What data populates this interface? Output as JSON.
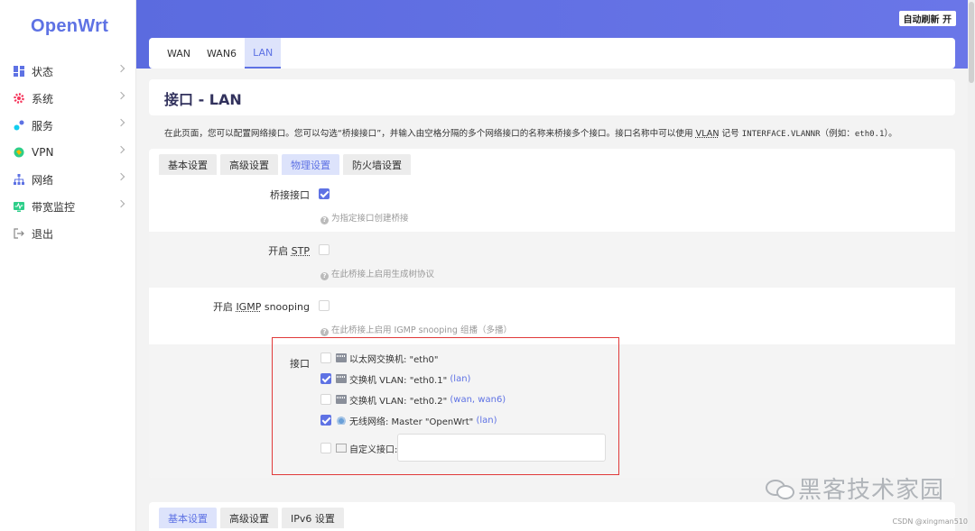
{
  "app": {
    "logo": "OpenWrt",
    "refresh_button": "自动刷新 开"
  },
  "sidebar": {
    "items": [
      {
        "label": "状态",
        "icon": "dashboard-icon",
        "color": "#5e72e4"
      },
      {
        "label": "系统",
        "icon": "gear-icon",
        "color": "#f5365c"
      },
      {
        "label": "服务",
        "icon": "services-icon",
        "color": "#11cdef"
      },
      {
        "label": "VPN",
        "icon": "vpn-icon",
        "color": "#2dce89"
      },
      {
        "label": "网络",
        "icon": "network-icon",
        "color": "#5e72e4"
      },
      {
        "label": "带宽监控",
        "icon": "monitor-icon",
        "color": "#2dce89"
      },
      {
        "label": "退出",
        "icon": "logout-icon",
        "color": "#888888"
      }
    ]
  },
  "top_tabs": [
    "WAN",
    "WAN6",
    "LAN"
  ],
  "page": {
    "title": "接口 - LAN",
    "desc_part1": "在此页面，您可以配置网络接口。您可以勾选“桥接接口”，并输入由空格分隔的多个网络接口的名称来桥接多个接口。接口名称中可以使用 ",
    "desc_vlan": "VLAN",
    "desc_part2": " 记号 ",
    "desc_code1": "INTERFACE.VLANNR",
    "desc_part3": "（例如：",
    "desc_code2": "eth0.1",
    "desc_part4": "）。"
  },
  "panel_tabs": [
    "基本设置",
    "高级设置",
    "物理设置",
    "防火墙设置"
  ],
  "settings": {
    "bridge": {
      "label": "桥接接口",
      "hint": "为指定接口创建桥接",
      "checked": true
    },
    "stp": {
      "label_prefix": "开启 ",
      "label_abbr": "STP",
      "hint": "在此桥接上启用生成树协议",
      "checked": false
    },
    "igmp": {
      "label_prefix": "开启 ",
      "label_abbr": "IGMP",
      "label_suffix": " snooping",
      "hint": "在此桥接上启用 IGMP snooping 组播（多播）",
      "checked": false
    },
    "interfaces": {
      "label": "接口",
      "items": [
        {
          "text": "以太网交换机: \"eth0\"",
          "zone": "",
          "checked": false,
          "icon": "ethernet-switch-icon"
        },
        {
          "text": "交换机 VLAN: \"eth0.1\" ",
          "zone": "(lan)",
          "checked": true,
          "icon": "ethernet-switch-icon"
        },
        {
          "text": "交换机 VLAN: \"eth0.2\" ",
          "zone": "(wan, wan6)",
          "checked": false,
          "icon": "ethernet-switch-icon"
        },
        {
          "text": "无线网络: Master \"OpenWrt\" ",
          "zone": "(lan)",
          "checked": true,
          "icon": "wifi-icon"
        }
      ],
      "custom_label": "自定义接口:",
      "custom_value": ""
    }
  },
  "bottom_tabs": [
    "基本设置",
    "高级设置",
    "IPv6 设置"
  ],
  "watermark": "黑客技术家园",
  "credit": "CSDN @xingman510"
}
